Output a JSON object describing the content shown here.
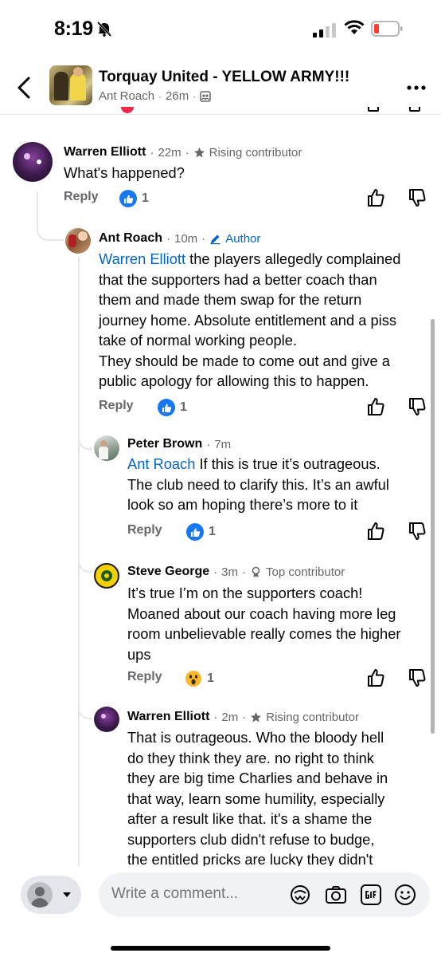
{
  "status_bar": {
    "time": "8:19"
  },
  "header": {
    "title": "Torquay United - YELLOW ARMY!!!",
    "author": "Ant Roach",
    "time": "26m"
  },
  "comments": [
    {
      "name": "Warren Elliott",
      "time": "22m",
      "badge": "Rising contributor",
      "body": "What's happened?",
      "reply_label": "Reply",
      "reaction_count": "1"
    },
    {
      "name": "Ant Roach",
      "time": "10m",
      "badge": "Author",
      "mention": "Warren Elliott",
      "body_lines": [
        " the players allegedly complained",
        "that the supporters had a better coach than",
        "them and made them swap for the return",
        "journey home. Absolute entitlement and a piss",
        "take of normal working people.",
        "They should be made to come out and give a",
        "public apology for allowing this to happen."
      ],
      "reply_label": "Reply",
      "reaction_count": "1"
    },
    {
      "name": "Peter Brown",
      "time": "7m",
      "mention": "Ant Roach",
      "body_lines": [
        " If this is true it’s outrageous.",
        "The club need to clarify this. It’s an awful",
        "look so am hoping there’s more to it"
      ],
      "reply_label": "Reply",
      "reaction_count": "1"
    },
    {
      "name": "Steve George",
      "time": "3m",
      "badge": "Top contributor",
      "body_lines": [
        "It’s true I’m on the supporters coach!",
        "Moaned about our coach having more leg",
        "room unbelievable really comes the higher",
        "ups"
      ],
      "reply_label": "Reply",
      "reaction_count": "1"
    },
    {
      "name": "Warren Elliott",
      "time": "2m",
      "badge": "Rising contributor",
      "body_lines": [
        "That is outrageous. Who the bloody hell",
        "do they think they are. no right to think",
        "they are big time Charlies and behave in",
        "that way, learn some humility, especially",
        "after a result like that. it's a shame the",
        "supporters club didn't refuse to budge,",
        "the entitled pricks are lucky they didn't"
      ]
    }
  ],
  "composer": {
    "placeholder": "Write a comment..."
  },
  "colors": {
    "link": "#0064d1",
    "like": "#1877f2",
    "muted": "#65676b"
  }
}
